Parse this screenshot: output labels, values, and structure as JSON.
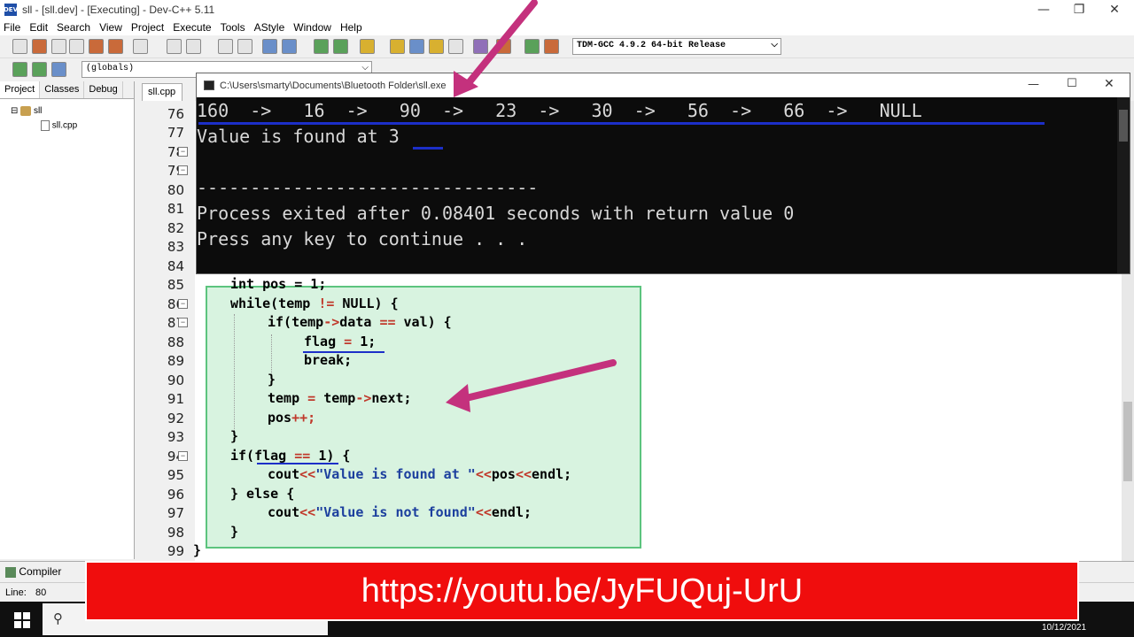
{
  "window": {
    "title": "sll - [sll.dev] - [Executing] - Dev-C++ 5.11",
    "icon_text": "DEV"
  },
  "menu": [
    "File",
    "Edit",
    "Search",
    "View",
    "Project",
    "Execute",
    "Tools",
    "AStyle",
    "Window",
    "Help"
  ],
  "toolbar": {
    "compiler": "TDM-GCC 4.9.2 64-bit Release",
    "scope": "(globals)"
  },
  "left_panel": {
    "tabs": [
      "Project",
      "Classes",
      "Debug"
    ],
    "tree": {
      "project": "sll",
      "file": "sll.cpp"
    }
  },
  "editor": {
    "tab": "sll.cpp",
    "line_numbers": [
      "76",
      "77",
      "78",
      "79",
      "80",
      "81",
      "82",
      "83",
      "84",
      "85",
      "86",
      "87",
      "88",
      "89",
      "90",
      "91",
      "92",
      "93",
      "94",
      "95",
      "96",
      "97",
      "98",
      "99"
    ],
    "code": {
      "l85": "int pos = 1;",
      "l86a": "while(temp ",
      "l86b": "!=",
      "l86c": " NULL) {",
      "l87a": "if(temp",
      "l87b": "->",
      "l87c": "data ",
      "l87d": "==",
      "l87e": " val) {",
      "l88a": "flag ",
      "l88b": "=",
      "l88c": " 1;",
      "l89": "break;",
      "l90": "}",
      "l91a": "temp ",
      "l91b": "=",
      "l91c": " temp",
      "l91d": "->",
      "l91e": "next;",
      "l92a": "pos",
      "l92b": "++;",
      "l93": "}",
      "l94a": "if(flag ",
      "l94b": "==",
      "l94c": " 1) {",
      "l95a": "cout",
      "l95b": "<<",
      "l95c": "\"Value is found at \"",
      "l95d": "<<",
      "l95e": "pos",
      "l95f": "<<",
      "l95g": "endl;",
      "l96": "} else {",
      "l97a": "cout",
      "l97b": "<<",
      "l97c": "\"Value is not found\"",
      "l97d": "<<",
      "l97e": "endl;",
      "l98": "}",
      "l99": "}"
    }
  },
  "console": {
    "path": "C:\\Users\\smarty\\Documents\\Bluetooth Folder\\sll.exe",
    "lines": [
      "160  ->   16  ->   90  ->   23  ->   30  ->   56  ->   66  ->   NULL",
      "Value is found at 3",
      "",
      "--------------------------------",
      "Process exited after 0.08401 seconds with return value 0",
      "Press any key to continue . . ."
    ]
  },
  "bottom": {
    "compiler_tab": "Compiler",
    "status_line_label": "Line:",
    "status_line_value": "80",
    "clock_date": "10/12/2021"
  },
  "banner": {
    "url": "https://youtu.be/JyFUQuj-UrU",
    "color": "#f00d0d"
  },
  "colors": {
    "arrow": "#c4317d",
    "underline": "#1c2fc8",
    "highlight_bg": "#d8f3e0",
    "highlight_border": "#5cc47e"
  }
}
